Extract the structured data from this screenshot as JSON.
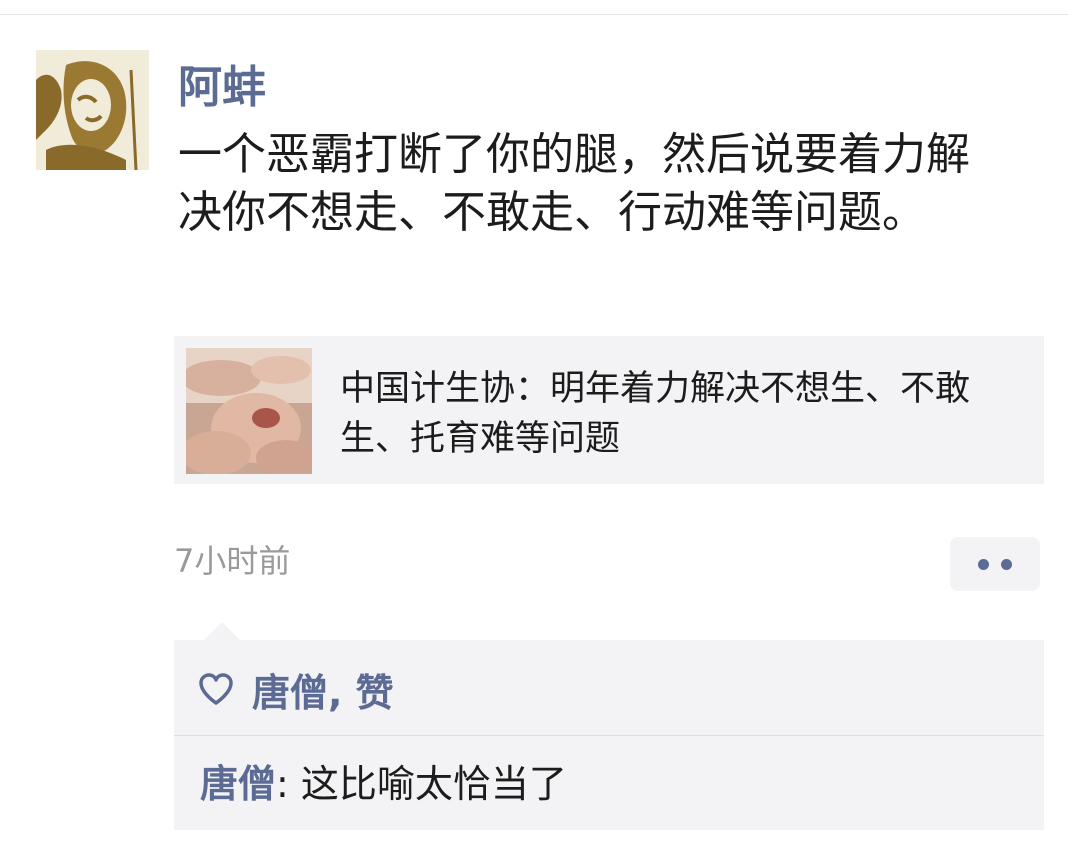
{
  "post": {
    "username": "阿蚌",
    "text": "一个恶霸打断了你的腿，然后说要着力解决你不想走、不敢走、行动难等问题。",
    "link_card": {
      "title": "中国计生协：明年着力解决不想生、不敢生、托育难等问题",
      "thumbnail_icon": "baby-photo"
    },
    "timestamp": "7小时前",
    "more_icon": "more-dots-icon"
  },
  "likes": {
    "icon": "heart-icon",
    "text": "唐僧, 赞"
  },
  "comments": [
    {
      "author": "唐僧",
      "separator": ": ",
      "text": "这比喻太恰当了"
    }
  ],
  "colors": {
    "name_blue": "#5b6b93",
    "card_bg": "#f3f3f5",
    "text": "#1c1c1c",
    "meta": "#9a9a9a"
  }
}
